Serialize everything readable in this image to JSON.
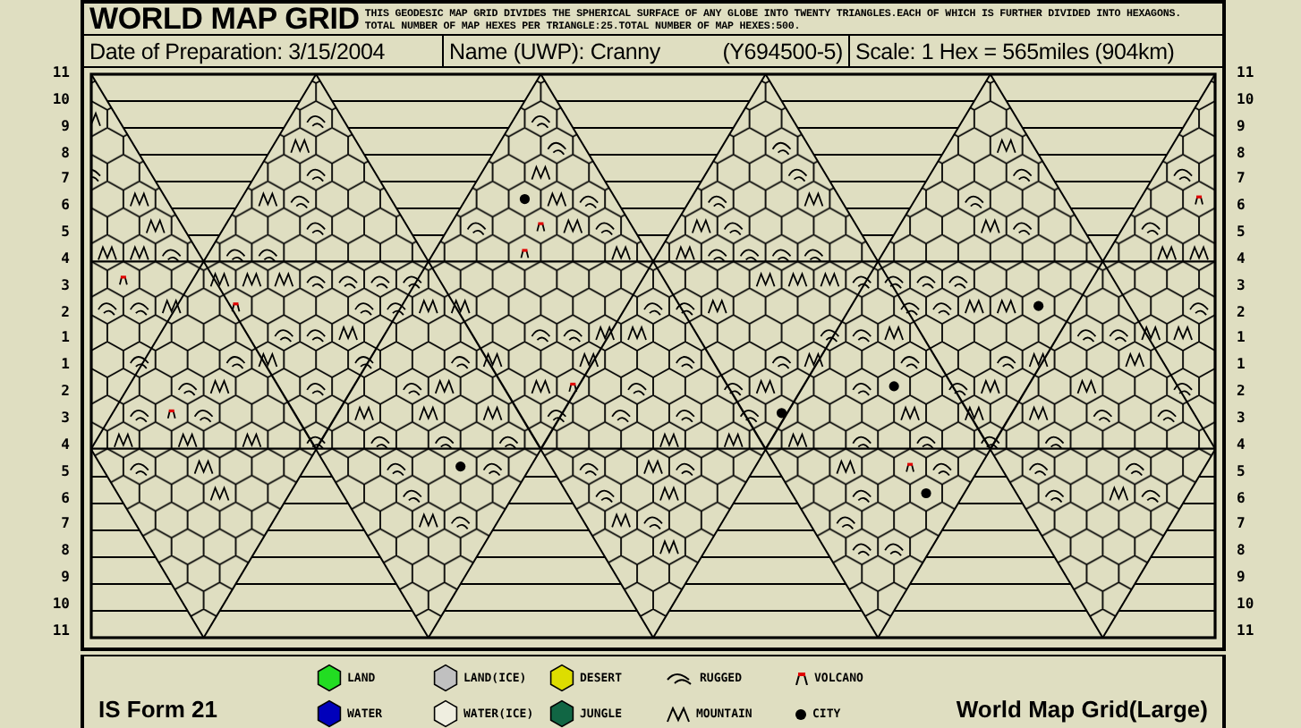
{
  "header": {
    "title": "WORLD MAP GRID",
    "description": [
      "THIS GEODESIC MAP GRID DIVIDES THE SPHERICAL SURFACE OF ANY GLOBE INTO TWENTY TRIANGLES.EACH OF WHICH IS FURTHER DIVIDED INTO HEXAGONS.",
      "TOTAL NUMBER OF MAP HEXES PER TRIANGLE:25.TOTAL NUMBER OF MAP HEXES:500."
    ]
  },
  "info": {
    "date": "Date of Preparation: 3/15/2004",
    "name": "Name (UWP): Cranny",
    "uwp": "(Y694500-5)",
    "scale": "Scale: 1 Hex = 565miles (904km)"
  },
  "left_row_labels": [
    "11",
    "10",
    "9",
    "8",
    "7",
    "6",
    "5",
    "4",
    "3",
    "2",
    "1",
    "1",
    "2",
    "3",
    "4",
    "5",
    "6",
    "7",
    "8",
    "9",
    "10",
    "11"
  ],
  "right_row_labels": [
    "11",
    "10",
    "9",
    "8",
    "7",
    "6",
    "5",
    "4",
    "3",
    "2",
    "1",
    "1",
    "2",
    "3",
    "4",
    "5",
    "6",
    "7",
    "8",
    "9",
    "10",
    "11"
  ],
  "legend": [
    {
      "label": "LAND",
      "kind": "hex",
      "color": "#22dd22"
    },
    {
      "label": "LAND(ICE)",
      "kind": "hex",
      "color": "#c0c0c0"
    },
    {
      "label": "DESERT",
      "kind": "hex",
      "color": "#dddd00"
    },
    {
      "label": "RUGGED",
      "kind": "rugged"
    },
    {
      "label": "VOLCANO",
      "kind": "volcano"
    },
    {
      "label": "WATER",
      "kind": "hex",
      "color": "#0000bb"
    },
    {
      "label": "WATER(ICE)",
      "kind": "hex",
      "color": "#efeee0"
    },
    {
      "label": "JUNGLE",
      "kind": "hex",
      "color": "#116644"
    },
    {
      "label": "MOUNTAIN",
      "kind": "mountain"
    },
    {
      "label": "CITY",
      "kind": "city"
    }
  ],
  "footer": {
    "form_id": "IS Form 21",
    "sheet_title": "World Map Grid(Large)"
  }
}
